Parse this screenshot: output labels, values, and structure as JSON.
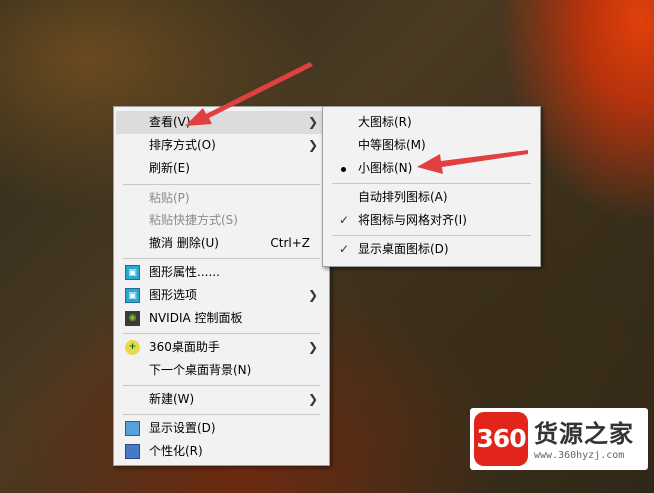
{
  "main_menu": {
    "view": "查看(V)",
    "sort": "排序方式(O)",
    "refresh": "刷新(E)",
    "paste": "粘贴(P)",
    "paste_shortcut": "粘贴快捷方式(S)",
    "undo_delete": "撤消 删除(U)",
    "undo_shortcut": "Ctrl+Z",
    "graphics_props": "图形属性......",
    "graphics_options": "图形选项",
    "nvidia": "NVIDIA 控制面板",
    "assistant_360": "360桌面助手",
    "next_bg": "下一个桌面背景(N)",
    "new": "新建(W)",
    "display": "显示设置(D)",
    "personalize": "个性化(R)"
  },
  "view_submenu": {
    "large": "大图标(R)",
    "medium": "中等图标(M)",
    "small": "小图标(N)",
    "auto_arrange": "自动排列图标(A)",
    "align_grid": "将图标与网格对齐(I)",
    "show_icons": "显示桌面图标(D)"
  },
  "watermark": {
    "badge": "360",
    "title": "货源之家",
    "url": "www.360hyzj.com"
  },
  "colors": {
    "menu_bg": "#f2f2f2",
    "hover_bg": "#dcdcdc",
    "annotation_arrow": "#e04040",
    "logo_red": "#e1251b"
  },
  "icons": [
    "graphics-icon",
    "nvidia-icon",
    "assistant-360-icon",
    "display-icon",
    "personalize-icon",
    "check-icon",
    "bullet-icon",
    "chevron-right-icon"
  ]
}
